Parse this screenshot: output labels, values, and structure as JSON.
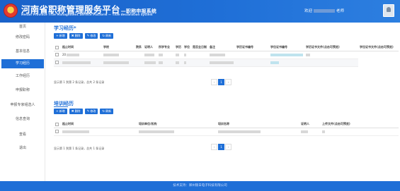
{
  "header": {
    "title": "河南省职称管理服务平台",
    "title_suffix": "—职称申报系统",
    "subtitle": "Henan Province Title Management Service Platform — Title declaration system",
    "welcome_prefix": "欢迎",
    "welcome_suffix": "老师"
  },
  "sidebar": {
    "items": [
      {
        "label": "首页"
      },
      {
        "label": "修改密码"
      },
      {
        "label": "基本信息"
      },
      {
        "label": "学习经历"
      },
      {
        "label": "工作经历"
      },
      {
        "label": "申报职称"
      },
      {
        "label": "申报专家组选人"
      },
      {
        "label": "信息查询"
      },
      {
        "label": "查看"
      },
      {
        "label": "退出"
      }
    ]
  },
  "study": {
    "title": "学习经历*",
    "buttons": {
      "add": "新增",
      "delete": "删除",
      "edit": "修改",
      "refresh": "刷新"
    },
    "columns": [
      "起止时间",
      "学校",
      "院系",
      "证明人",
      "所学专业",
      "学历",
      "学位",
      "是否全日制",
      "备注",
      "学历证书编号",
      "学位证书编号",
      "学历证书文件(点击可预览)",
      "学位证书文件(点击可预览)"
    ],
    "rows": [
      {
        "start": "20"
      },
      {
        "start": ""
      }
    ],
    "pager_text": "显示第 1 到第 2 条记录，总共 2 条记录",
    "page": "1"
  },
  "training": {
    "title": "培训经历",
    "buttons": {
      "add": "新增",
      "delete": "删除",
      "edit": "修改",
      "refresh": "刷新"
    },
    "columns": [
      "起止时间",
      "培训单位/机构",
      "培训名称",
      "证明人",
      "上传文件(点击可预览)"
    ],
    "rows": [
      {
        "start": ""
      }
    ],
    "pager_text": "显示第 1 到第 1 条记录，总共 1 条记录",
    "page": "1"
  },
  "footer": {
    "text": "技术支持：郑州银日电子科技有限公司"
  },
  "colors": {
    "primary": "#1f6fd7",
    "header": "#1a62c9"
  }
}
